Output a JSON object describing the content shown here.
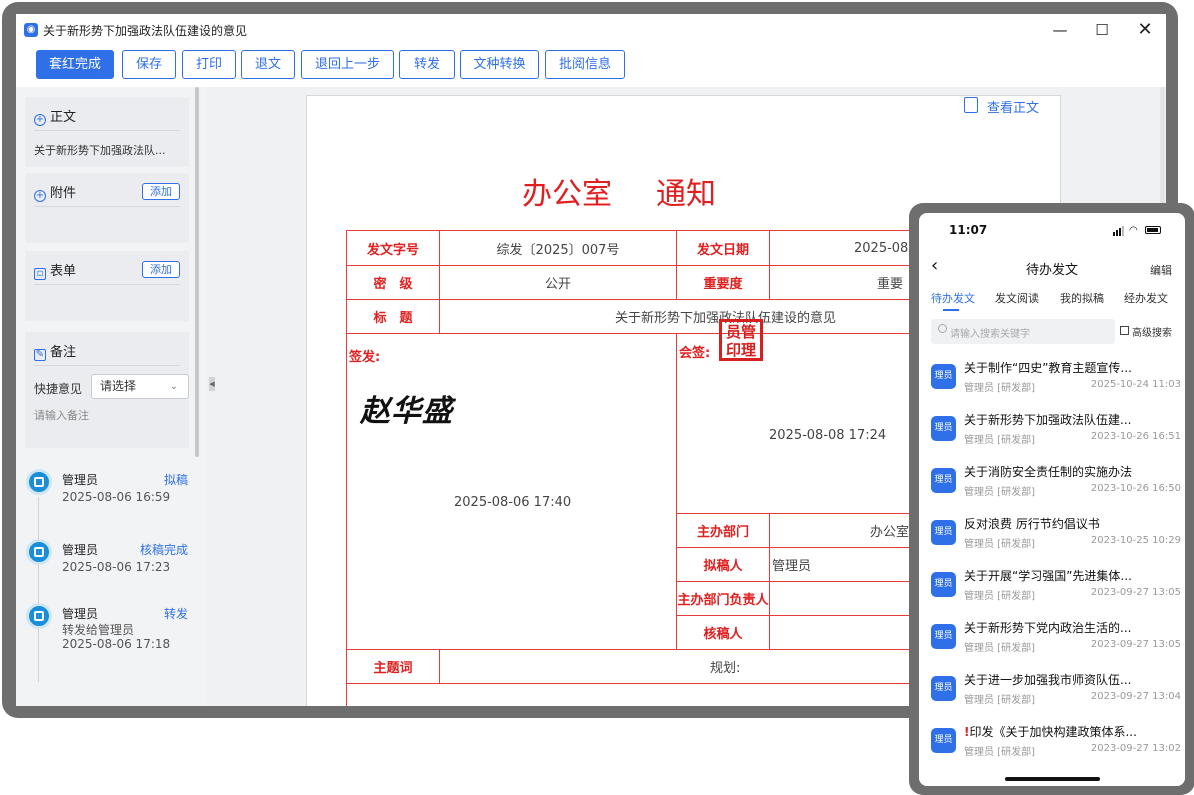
{
  "window": {
    "title": "关于新形势下加强政法队伍建设的意见",
    "controls": {
      "minimize": "—",
      "maximize": "☐",
      "close": "✕"
    }
  },
  "toolbar": {
    "buttons": [
      "套红完成",
      "保存",
      "打印",
      "退文",
      "退回上一步",
      "转发",
      "文种转换",
      "批阅信息"
    ]
  },
  "left_panel": {
    "zhengwen": {
      "label": "正文",
      "file": "关于新形势下加强政法队..."
    },
    "fujian": {
      "label": "附件",
      "add": "添加"
    },
    "biaodan": {
      "label": "表单",
      "add": "添加"
    },
    "beizhu": {
      "label": "备注",
      "quick_label": "快捷意见",
      "select_value": "请选择",
      "placeholder": "请输入备注"
    },
    "timeline": [
      {
        "name": "管理员",
        "action": "拟稿",
        "time": "2025-08-06 16:59"
      },
      {
        "name": "管理员",
        "action": "核稿完成",
        "time": "2025-08-06 17:23"
      },
      {
        "name": "管理员",
        "action": "转发",
        "note": "转发给管理员",
        "time": "2025-08-06 17:18"
      }
    ]
  },
  "document": {
    "view_link": "查看正文",
    "title_left": "办公室",
    "title_right": "通知",
    "labels": {
      "doc_no": "发文字号",
      "doc_date": "发文日期",
      "secret": "密　级",
      "importance": "重要度",
      "subject": "标　题",
      "sign": "签发:",
      "countersign": "会签:",
      "dept": "主办部门",
      "drafter": "拟稿人",
      "dept_head": "主办部门负责人",
      "reviewer": "核稿人",
      "keywords": "主题词"
    },
    "values": {
      "doc_no": "综发〔2025〕007号",
      "doc_date": "2025-08-08",
      "secret": "公开",
      "importance": "重要",
      "subject": "关于新形势下加强政法队伍建设的意见",
      "dept": "办公室",
      "drafter": "管理员",
      "keywords": "规划:"
    },
    "seal": {
      "line1": "员管",
      "line2": "印理"
    },
    "seal_time": "2025-08-08 17:24",
    "signature": "赵华盛",
    "sign_time": "2025-08-06 17:40"
  },
  "phone": {
    "time": "11:07",
    "title": "待办发文",
    "edit": "编辑",
    "tabs": [
      "待办发文",
      "发文阅读",
      "我的拟稿",
      "经办发文"
    ],
    "search_placeholder": "请输入搜索关键字",
    "advanced": "高级搜索",
    "items": [
      {
        "badge": "理员",
        "title": "关于制作“四史”教育主题宣传...",
        "meta": "管理员 [研发部]",
        "date": "2025-10-24 11:03",
        "urgent": false
      },
      {
        "badge": "理员",
        "title": "关于新形势下加强政法队伍建...",
        "meta": "管理员 [研发部]",
        "date": "2023-10-26 16:51",
        "urgent": false
      },
      {
        "badge": "理员",
        "title": "关于消防安全责任制的实施办法",
        "meta": "管理员 [研发部]",
        "date": "2023-10-26 16:50",
        "urgent": false
      },
      {
        "badge": "理员",
        "title": "反对浪费 厉行节约倡议书",
        "meta": "管理员 [研发部]",
        "date": "2023-10-25 10:29",
        "urgent": false
      },
      {
        "badge": "理员",
        "title": "关于开展“学习强国”先进集体...",
        "meta": "管理员 [研发部]",
        "date": "2023-09-27 13:05",
        "urgent": false
      },
      {
        "badge": "理员",
        "title": "关于新形势下党内政治生活的...",
        "meta": "管理员 [研发部]",
        "date": "2023-09-27 13:05",
        "urgent": false
      },
      {
        "badge": "理员",
        "title": "关于进一步加强我市师资队伍...",
        "meta": "管理员 [研发部]",
        "date": "2023-09-27 13:04",
        "urgent": false
      },
      {
        "badge": "理员",
        "title": "印发《关于加快构建政策体系...",
        "meta": "管理员 [研发部]",
        "date": "2023-09-27 13:02",
        "urgent": true,
        "urgent_mark": "!"
      }
    ]
  }
}
